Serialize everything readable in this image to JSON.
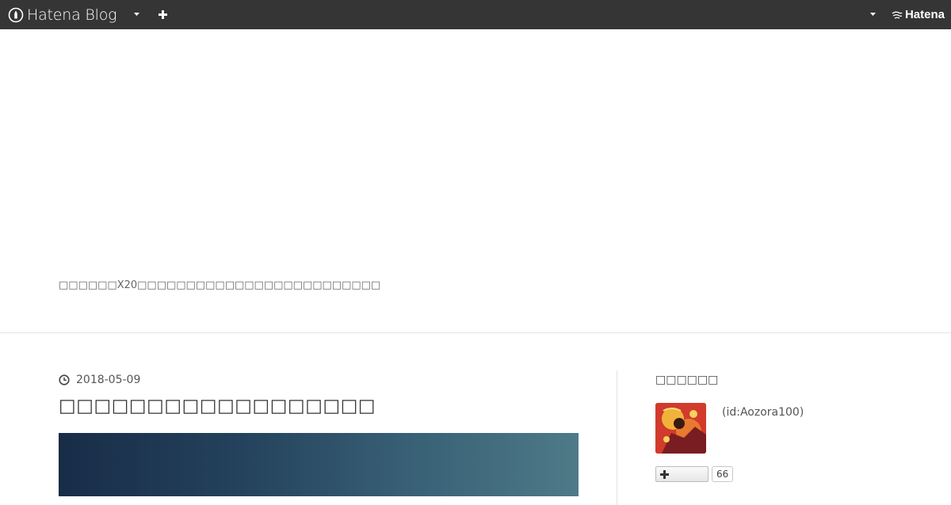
{
  "globalheader": {
    "logo_text": "Hatena Blog",
    "menu_icon": "chevron-down-icon",
    "add_icon": "plus-icon",
    "account_icon": "chevron-down-icon",
    "hatena_text": "Hatena",
    "background_color": "#353535"
  },
  "blog": {
    "description": "□□□□□□X20□□□□□□□□□□□□□□□□□□□□□□□□□"
  },
  "entry": {
    "date": "2018-05-09",
    "title": "□□□□□□□□□□□□□□□□□□"
  },
  "sidebar": {
    "profile_title": "□□□□□□",
    "profile_id": "(id:Aozora100)",
    "subscribe_count": "66"
  }
}
